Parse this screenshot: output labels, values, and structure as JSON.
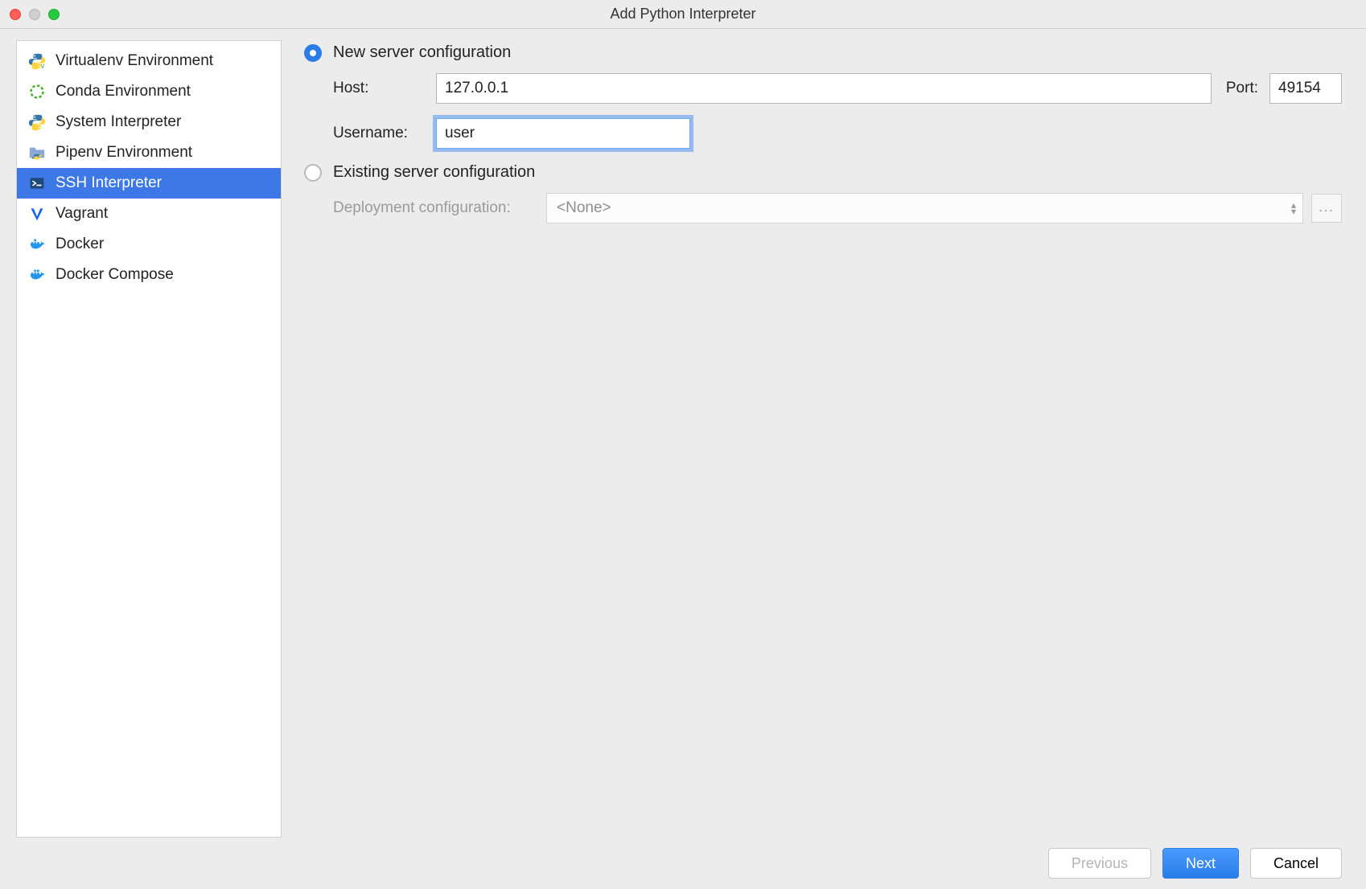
{
  "window": {
    "title": "Add Python Interpreter"
  },
  "sidebar": {
    "items": [
      {
        "label": "Virtualenv Environment"
      },
      {
        "label": "Conda Environment"
      },
      {
        "label": "System Interpreter"
      },
      {
        "label": "Pipenv Environment"
      },
      {
        "label": "SSH Interpreter"
      },
      {
        "label": "Vagrant"
      },
      {
        "label": "Docker"
      },
      {
        "label": "Docker Compose"
      }
    ]
  },
  "main": {
    "new_server_label": "New server configuration",
    "existing_server_label": "Existing server configuration",
    "host_label": "Host:",
    "host_value": "127.0.0.1",
    "port_label": "Port:",
    "port_value": "49154",
    "username_label": "Username:",
    "username_value": "user",
    "deploy_label": "Deployment configuration:",
    "deploy_value": "<None>",
    "browse": "..."
  },
  "footer": {
    "previous": "Previous",
    "next": "Next",
    "cancel": "Cancel"
  }
}
